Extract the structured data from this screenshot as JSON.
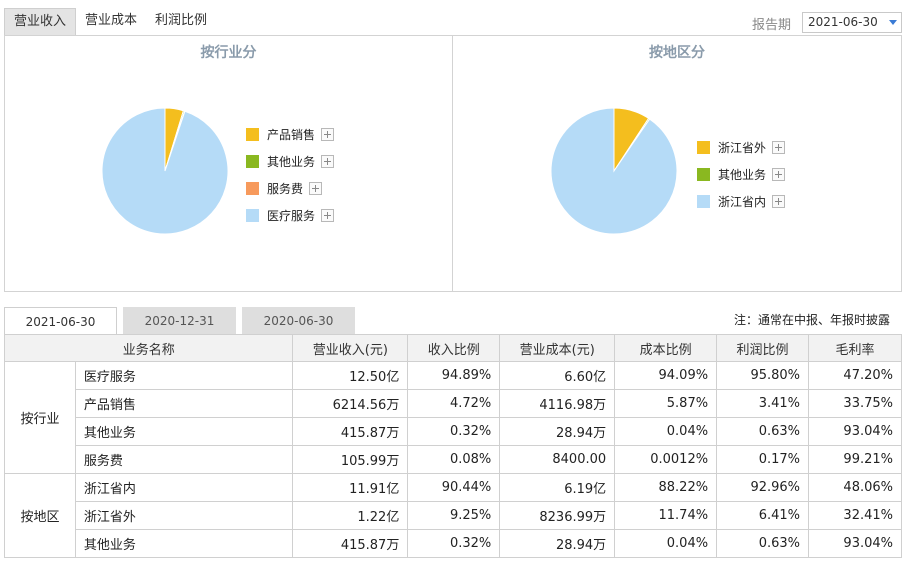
{
  "top_tabs": [
    "营业收入",
    "营业成本",
    "利润比例"
  ],
  "report_period": {
    "label": "报告期",
    "value": "2021-06-30"
  },
  "charts": {
    "industry": {
      "title": "按行业分",
      "legend": [
        {
          "label": "产品销售",
          "color": "#f4be1e"
        },
        {
          "label": "其他业务",
          "color": "#8ab820"
        },
        {
          "label": "服务费",
          "color": "#f79a5c"
        },
        {
          "label": "医疗服务",
          "color": "#b5dbf7"
        }
      ]
    },
    "region": {
      "title": "按地区分",
      "legend": [
        {
          "label": "浙江省外",
          "color": "#f4be1e"
        },
        {
          "label": "其他业务",
          "color": "#8ab820"
        },
        {
          "label": "浙江省内",
          "color": "#b5dbf7"
        }
      ]
    }
  },
  "chart_data": [
    {
      "type": "pie",
      "title": "按行业分",
      "categories": [
        "产品销售",
        "其他业务",
        "服务费",
        "医疗服务"
      ],
      "values": [
        4.72,
        0.32,
        0.08,
        94.89
      ],
      "colors": [
        "#f4be1e",
        "#8ab820",
        "#f79a5c",
        "#b5dbf7"
      ],
      "legend_position": "right"
    },
    {
      "type": "pie",
      "title": "按地区分",
      "categories": [
        "浙江省外",
        "其他业务",
        "浙江省内"
      ],
      "values": [
        9.25,
        0.32,
        90.44
      ],
      "colors": [
        "#f4be1e",
        "#8ab820",
        "#b5dbf7"
      ],
      "legend_position": "right"
    }
  ],
  "period_tabs": [
    "2021-06-30",
    "2020-12-31",
    "2020-06-30"
  ],
  "note": "注：通常在中报、年报时披露",
  "table": {
    "headers": [
      "业务名称",
      "营业收入(元)",
      "收入比例",
      "营业成本(元)",
      "成本比例",
      "利润比例",
      "毛利率"
    ],
    "groups": [
      {
        "label": "按行业",
        "rows": [
          [
            "医疗服务",
            "12.50亿",
            "94.89%",
            "6.60亿",
            "94.09%",
            "95.80%",
            "47.20%"
          ],
          [
            "产品销售",
            "6214.56万",
            "4.72%",
            "4116.98万",
            "5.87%",
            "3.41%",
            "33.75%"
          ],
          [
            "其他业务",
            "415.87万",
            "0.32%",
            "28.94万",
            "0.04%",
            "0.63%",
            "93.04%"
          ],
          [
            "服务费",
            "105.99万",
            "0.08%",
            "8400.00",
            "0.0012%",
            "0.17%",
            "99.21%"
          ]
        ]
      },
      {
        "label": "按地区",
        "rows": [
          [
            "浙江省内",
            "11.91亿",
            "90.44%",
            "6.19亿",
            "88.22%",
            "92.96%",
            "48.06%"
          ],
          [
            "浙江省外",
            "1.22亿",
            "9.25%",
            "8236.99万",
            "11.74%",
            "6.41%",
            "32.41%"
          ],
          [
            "其他业务",
            "415.87万",
            "0.32%",
            "28.94万",
            "0.04%",
            "0.63%",
            "93.04%"
          ]
        ]
      }
    ]
  }
}
